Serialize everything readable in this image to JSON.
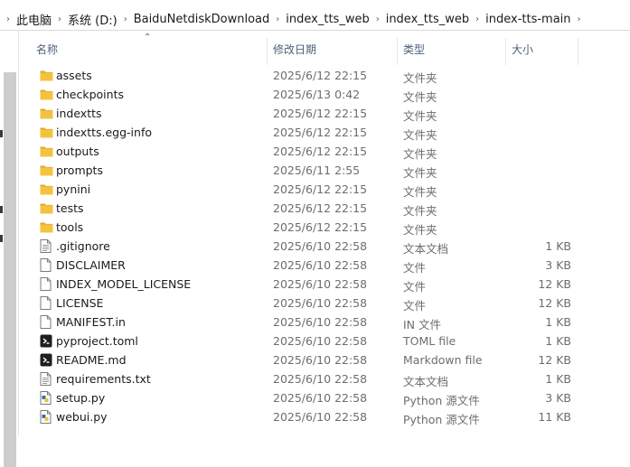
{
  "breadcrumb": [
    "此电脑",
    "系统 (D:)",
    "BaiduNetdiskDownload",
    "index_tts_web",
    "index_tts_web",
    "index-tts-main"
  ],
  "columns": {
    "name": "名称",
    "date": "修改日期",
    "type": "类型",
    "size": "大小"
  },
  "files": [
    {
      "name": "assets",
      "date": "2025/6/12 22:15",
      "type": "文件夹",
      "size": "",
      "icon": "folder-icon"
    },
    {
      "name": "checkpoints",
      "date": "2025/6/13 0:42",
      "type": "文件夹",
      "size": "",
      "icon": "folder-icon"
    },
    {
      "name": "indextts",
      "date": "2025/6/12 22:15",
      "type": "文件夹",
      "size": "",
      "icon": "folder-icon"
    },
    {
      "name": "indextts.egg-info",
      "date": "2025/6/12 22:15",
      "type": "文件夹",
      "size": "",
      "icon": "folder-icon"
    },
    {
      "name": "outputs",
      "date": "2025/6/12 22:15",
      "type": "文件夹",
      "size": "",
      "icon": "folder-icon"
    },
    {
      "name": "prompts",
      "date": "2025/6/11 2:55",
      "type": "文件夹",
      "size": "",
      "icon": "folder-icon"
    },
    {
      "name": "pynini",
      "date": "2025/6/12 22:15",
      "type": "文件夹",
      "size": "",
      "icon": "folder-icon"
    },
    {
      "name": "tests",
      "date": "2025/6/12 22:15",
      "type": "文件夹",
      "size": "",
      "icon": "folder-icon"
    },
    {
      "name": "tools",
      "date": "2025/6/12 22:15",
      "type": "文件夹",
      "size": "",
      "icon": "folder-icon"
    },
    {
      "name": ".gitignore",
      "date": "2025/6/10 22:58",
      "type": "文本文档",
      "size": "1 KB",
      "icon": "text-file-icon"
    },
    {
      "name": "DISCLAIMER",
      "date": "2025/6/10 22:58",
      "type": "文件",
      "size": "3 KB",
      "icon": "blank-file-icon"
    },
    {
      "name": "INDEX_MODEL_LICENSE",
      "date": "2025/6/10 22:58",
      "type": "文件",
      "size": "12 KB",
      "icon": "blank-file-icon"
    },
    {
      "name": "LICENSE",
      "date": "2025/6/10 22:58",
      "type": "文件",
      "size": "12 KB",
      "icon": "blank-file-icon"
    },
    {
      "name": "MANIFEST.in",
      "date": "2025/6/10 22:58",
      "type": "IN 文件",
      "size": "1 KB",
      "icon": "blank-file-icon"
    },
    {
      "name": "pyproject.toml",
      "date": "2025/6/10 22:58",
      "type": "TOML file",
      "size": "1 KB",
      "icon": "dark-app-file-icon"
    },
    {
      "name": "README.md",
      "date": "2025/6/10 22:58",
      "type": "Markdown file",
      "size": "12 KB",
      "icon": "dark-app-file-icon"
    },
    {
      "name": "requirements.txt",
      "date": "2025/6/10 22:58",
      "type": "文本文档",
      "size": "1 KB",
      "icon": "text-file-icon"
    },
    {
      "name": "setup.py",
      "date": "2025/6/10 22:58",
      "type": "Python 源文件",
      "size": "3 KB",
      "icon": "python-file-icon"
    },
    {
      "name": "webui.py",
      "date": "2025/6/10 22:58",
      "type": "Python 源文件",
      "size": "11 KB",
      "icon": "python-file-icon"
    }
  ],
  "colors": {
    "folder": "#f3c340",
    "folder_dark": "#dca92a",
    "header_text": "#4c607a",
    "secondary_text": "#6d6d6d"
  }
}
